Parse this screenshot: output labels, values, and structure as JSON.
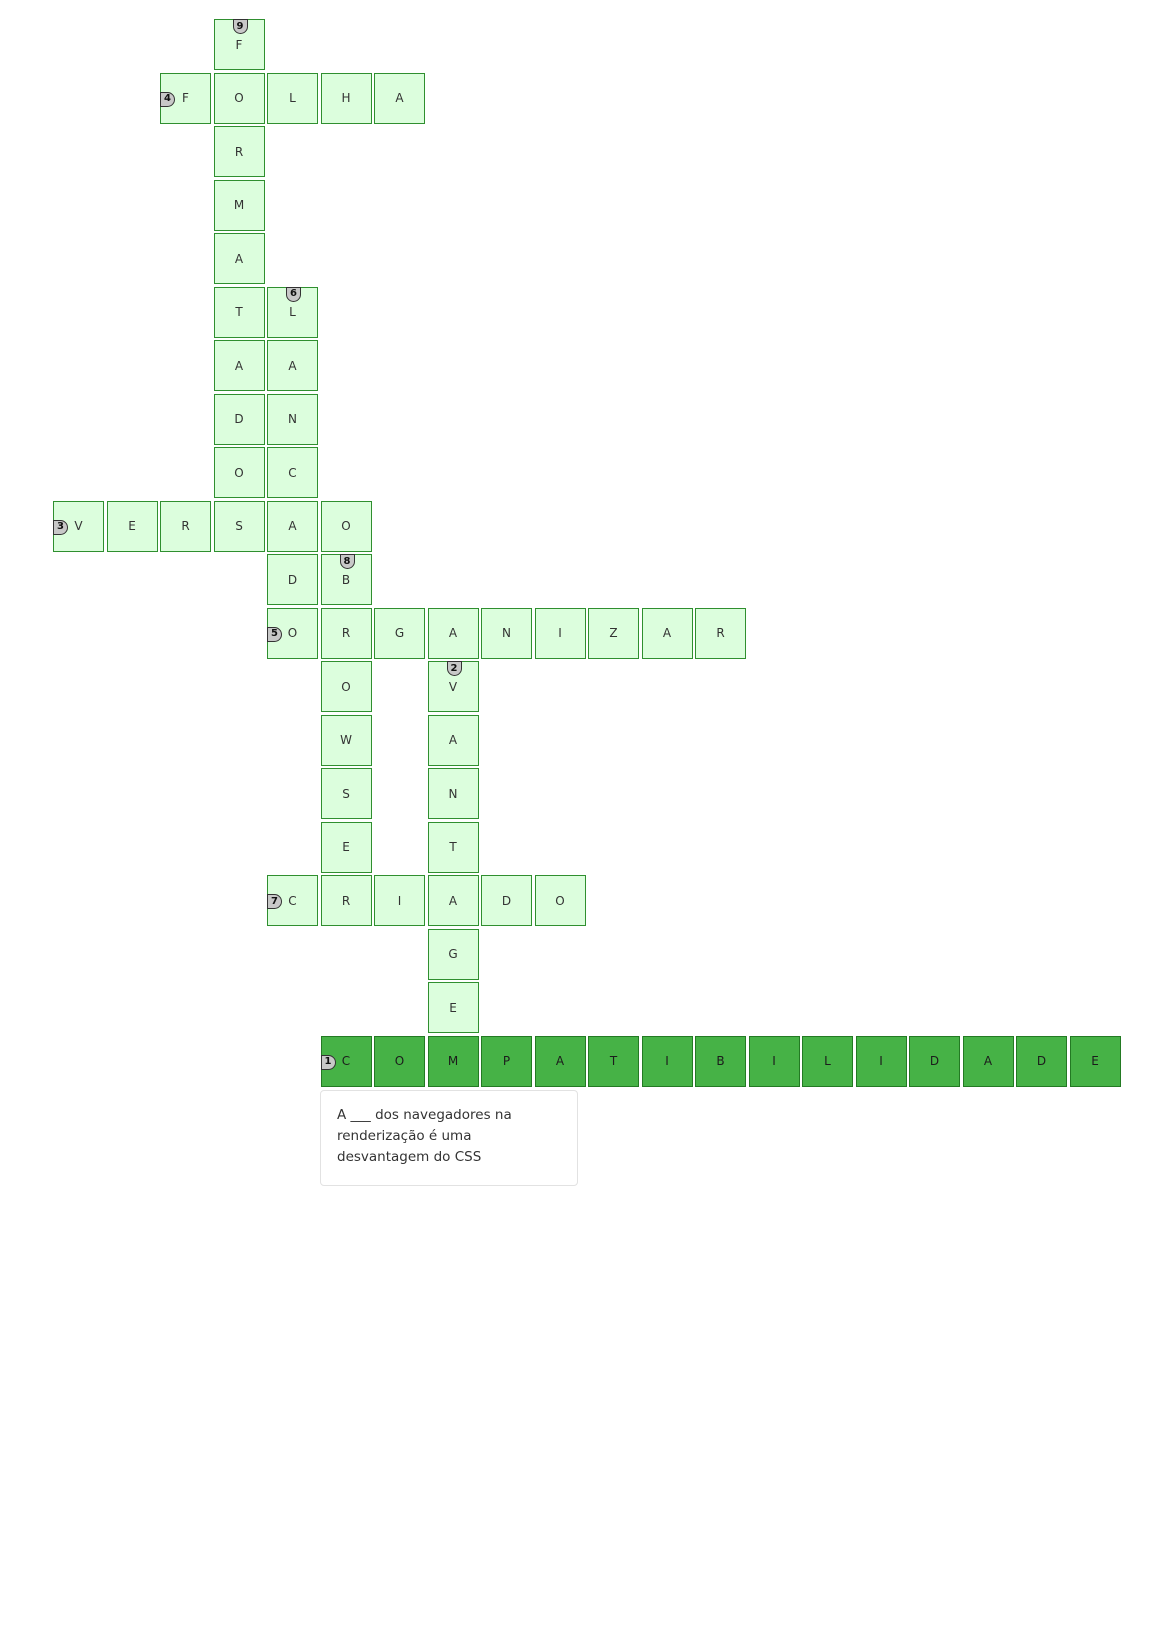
{
  "words": [
    {
      "number": "1",
      "answer": "COMPATIBILIDADE",
      "direction": "across",
      "row": 19,
      "col": 5,
      "active": true
    },
    {
      "number": "2",
      "answer": "VANTAGE",
      "direction": "down",
      "row": 12,
      "col": 7
    },
    {
      "number": "3",
      "answer": "VERSAO",
      "direction": "across",
      "row": 9,
      "col": 0
    },
    {
      "number": "4",
      "answer": "FOLHA",
      "direction": "across",
      "row": 1,
      "col": 2
    },
    {
      "number": "5",
      "answer": "ORGANIZAR",
      "direction": "across",
      "row": 11,
      "col": 4
    },
    {
      "number": "6",
      "answer": "LANCAD",
      "direction": "down",
      "row": 5,
      "col": 4
    },
    {
      "number": "7",
      "answer": "CRIADO",
      "direction": "across",
      "row": 16,
      "col": 4
    },
    {
      "number": "8",
      "answer": "BROWSER",
      "direction": "down",
      "row": 10,
      "col": 5
    },
    {
      "number": "9",
      "answer": "FORMATADOS",
      "direction": "down",
      "row": 0,
      "col": 3
    }
  ],
  "fixed_cells": [
    {
      "row": 9,
      "col": 5,
      "letter": "O"
    }
  ],
  "clue": {
    "text": "A ___ dos navegadores na renderização é uma desvantagem do CSS"
  },
  "colors": {
    "cell_fill": "#dcfedd",
    "cell_border": "#2f8f2f",
    "active_fill": "#46b246",
    "number_badge": "#c8c8c8"
  }
}
